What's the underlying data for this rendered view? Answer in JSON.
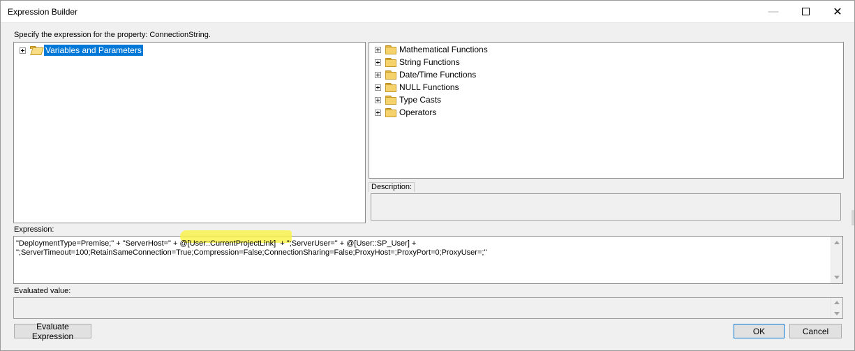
{
  "window": {
    "title": "Expression Builder",
    "minimize_glyph": "—",
    "close_glyph": "✕"
  },
  "prompt": "Specify the expression for the property: ConnectionString.",
  "left_tree": {
    "items": [
      {
        "label": "Variables and Parameters",
        "icon": "folder-open-icon",
        "selected": true
      }
    ]
  },
  "right_tree": {
    "items": [
      {
        "label": "Mathematical Functions",
        "icon": "folder-icon"
      },
      {
        "label": "String Functions",
        "icon": "folder-icon"
      },
      {
        "label": "Date/Time Functions",
        "icon": "folder-icon"
      },
      {
        "label": "NULL Functions",
        "icon": "folder-icon"
      },
      {
        "label": "Type Casts",
        "icon": "folder-icon"
      },
      {
        "label": "Operators",
        "icon": "folder-icon"
      }
    ]
  },
  "description": {
    "tab_label": "Description:",
    "value": ""
  },
  "expression": {
    "label": "Expression:",
    "value": "\"DeploymentType=Premise;\" + \"ServerHost=\" + @[User::CurrentProjectLink]  + \";ServerUser=\" + @[User::SP_User] +\n\";ServerTimeout=100;RetainSameConnection=True;Compression=False;ConnectionSharing=False;ProxyHost=;ProxyPort=0;ProxyUser=;\"",
    "highlight_color": "#f9f24f"
  },
  "evaluated": {
    "label": "Evaluated value:",
    "value": ""
  },
  "buttons": {
    "evaluate": "Evaluate Expression",
    "ok": "OK",
    "cancel": "Cancel"
  },
  "colors": {
    "selection": "#0078d7",
    "folder": "#f5d26b"
  }
}
